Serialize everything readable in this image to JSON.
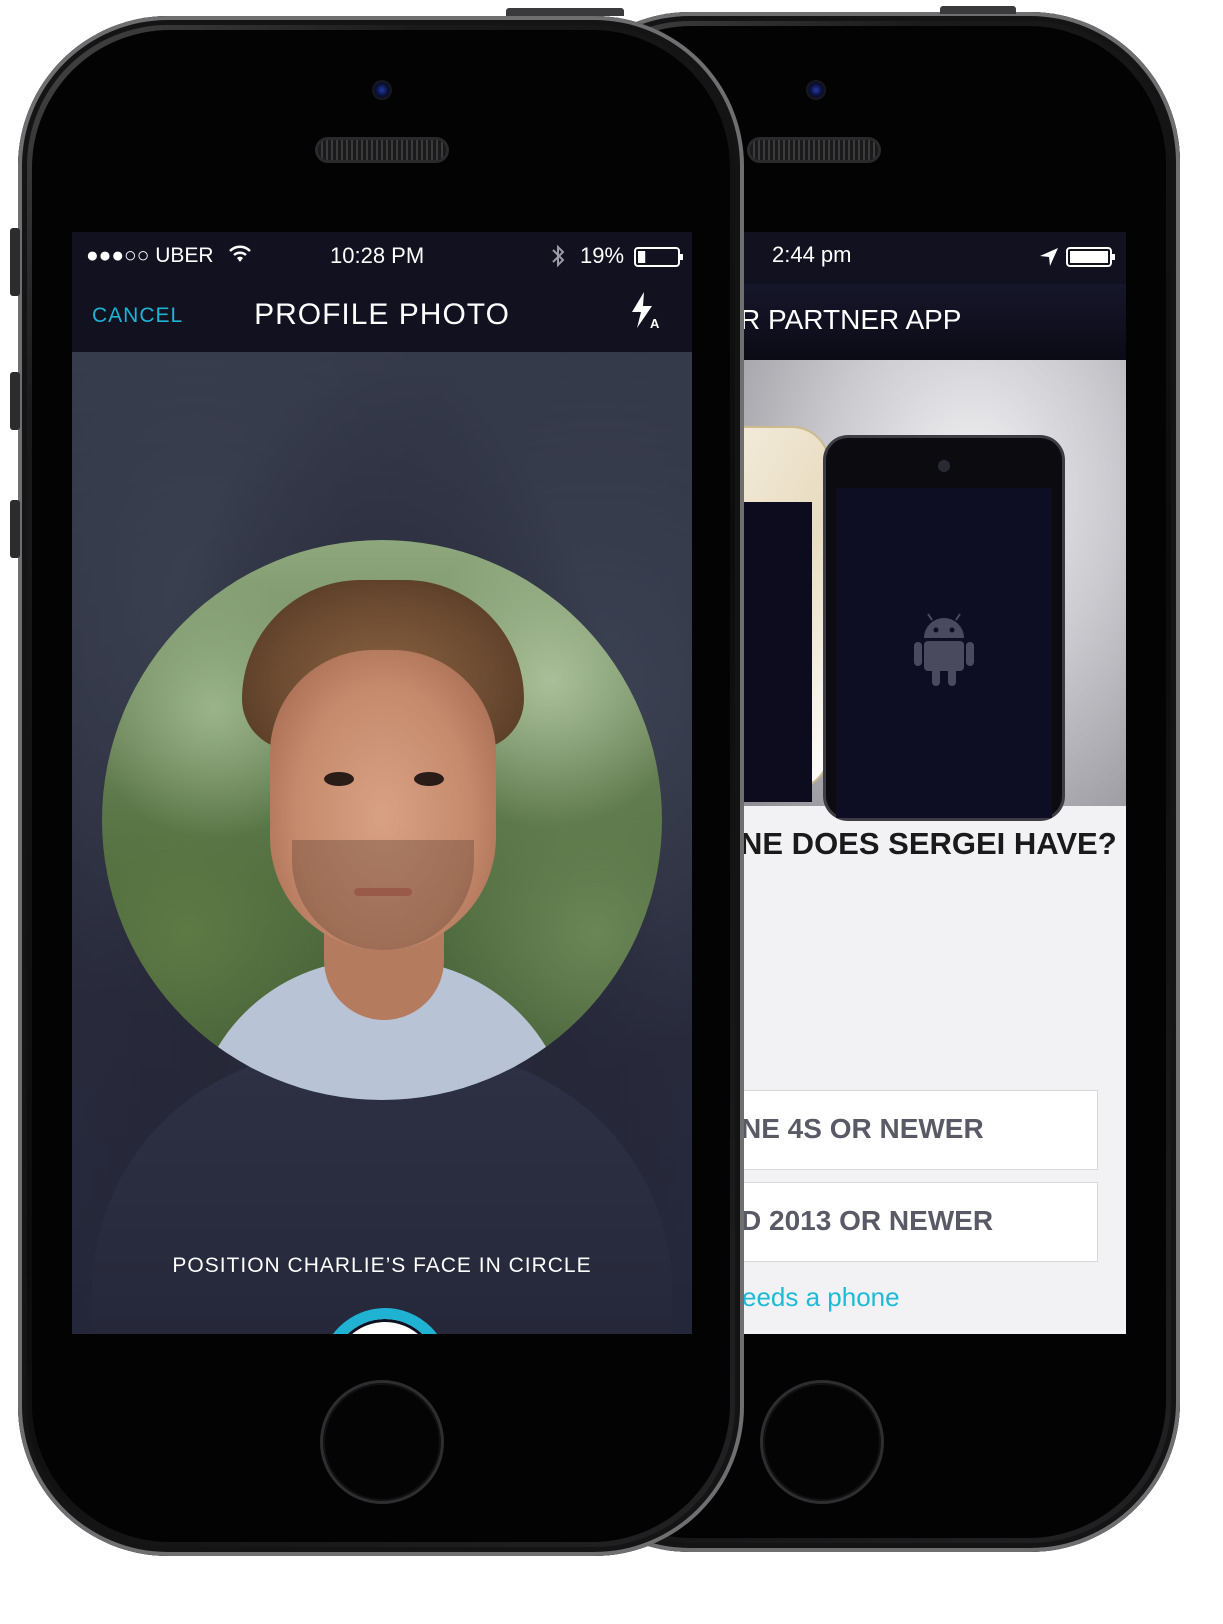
{
  "front_phone": {
    "status_bar": {
      "carrier": "●●●○○ UBER",
      "time": "10:28 PM",
      "battery_percent": "19%",
      "battery_level": 0.19
    },
    "header": {
      "cancel_label": "CANCEL",
      "title": "PROFILE PHOTO",
      "flash_mode": "A"
    },
    "camera_hint": "POSITION CHARLIE’S FACE IN CIRCLE"
  },
  "back_phone": {
    "status_bar": {
      "time": "2:44 pm",
      "battery_level": 1.0
    },
    "header_title": "R PARTNER APP",
    "question": "NE DOES SERGEI HAVE?",
    "options": [
      {
        "label": "NE 4S OR NEWER"
      },
      {
        "label": "D 2013 OR NEWER"
      }
    ],
    "link_text": "eeds a phone"
  },
  "colors": {
    "accent": "#1FB2D2",
    "header_bg": "#111120",
    "overlay": "#2B2C3C"
  },
  "icons": [
    "wifi-icon",
    "bluetooth-icon",
    "battery-icon",
    "location-arrow-icon",
    "flash-auto-icon",
    "android-icon"
  ]
}
